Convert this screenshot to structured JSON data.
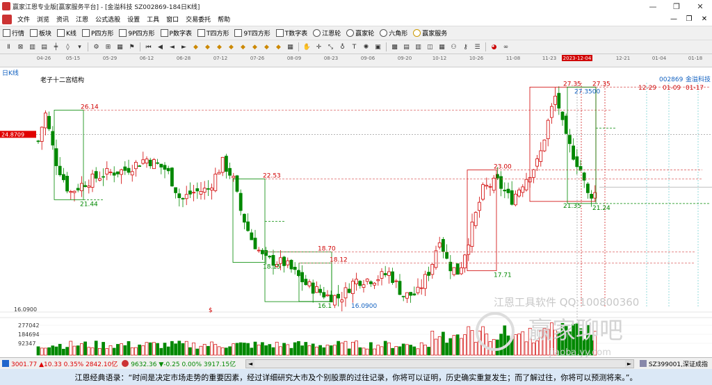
{
  "window": {
    "title": "赢家江恩专业版[赢家服务平台] - [金溢科技  SZ002869-184日K线]",
    "min_icon": "minimize-icon",
    "max_icon": "maximize-icon",
    "close_icon": "close-icon"
  },
  "menu": [
    "文件",
    "浏览",
    "资讯",
    "江恩",
    "公式选股",
    "设置",
    "工具",
    "窗口",
    "交易委托",
    "帮助"
  ],
  "toolbar1": [
    {
      "label": "行情"
    },
    {
      "label": "板块"
    },
    {
      "label": "K线"
    },
    {
      "label": "P四方形"
    },
    {
      "label": "9P四方形"
    },
    {
      "label": "P数字表"
    },
    {
      "label": "T四方形"
    },
    {
      "label": "9T四方形"
    },
    {
      "label": "T数字表"
    },
    {
      "label": "江恩轮"
    },
    {
      "label": "赢家轮"
    },
    {
      "label": "六角形"
    },
    {
      "label": "赢家服务"
    }
  ],
  "chart": {
    "period_label": "日K线",
    "structure_label": "老子十二宫结构",
    "price_tag": "24.8709",
    "low_axis": "16.0900",
    "vol_axis": [
      "277042",
      "184694",
      "92347"
    ],
    "code_label": "002869",
    "name_label": "金溢科技",
    "watermark_1": "江恩工具软件 QQ:100800360",
    "watermark_2": "赢家聊吧",
    "watermark_3": "jiaoba.yy.com",
    "dates": [
      "04-26",
      "05-15",
      "05-29",
      "06-12",
      "06-28",
      "07-12",
      "07-26",
      "08-09",
      "08-23",
      "09-06",
      "09-20",
      "10-12",
      "10-26",
      "11-08",
      "11-23",
      "2023-12-04",
      "12-21",
      "01-04",
      "01-18"
    ],
    "right_dates": [
      "12-29",
      "01-09",
      "01-17"
    ],
    "labels": {
      "p1": "26.14",
      "p2": "21.44",
      "p3": "22.53",
      "p4": "18.15",
      "p5": "18.70",
      "p6": "18.12",
      "p7": "16.1",
      "p8": "16.0900",
      "p9": "23.00",
      "p10": "17.71",
      "p11": "27.35",
      "p12": "27.3500",
      "p13": "27.35",
      "p14": "21.35",
      "p15": "21.24",
      "p16": "16.1",
      "p17": "$"
    }
  },
  "status": {
    "sh": "3001.77 ▲10.33 0.35% 2842.10亿",
    "sz": "9632.36 ▼-0.25 0.00% 3917.15亿",
    "right": "SZ399001,深证成指"
  },
  "quote": "江恩经典语录：“时间是决定市场走势的重要因素，经过详细研究大市及个别股票的过往记录，你将可以证明，历史确实重复发生；而了解过往，你将可以预测将来。”。",
  "colors": {
    "up": "#d00000",
    "down": "#008800",
    "accent": "#1060c0"
  }
}
